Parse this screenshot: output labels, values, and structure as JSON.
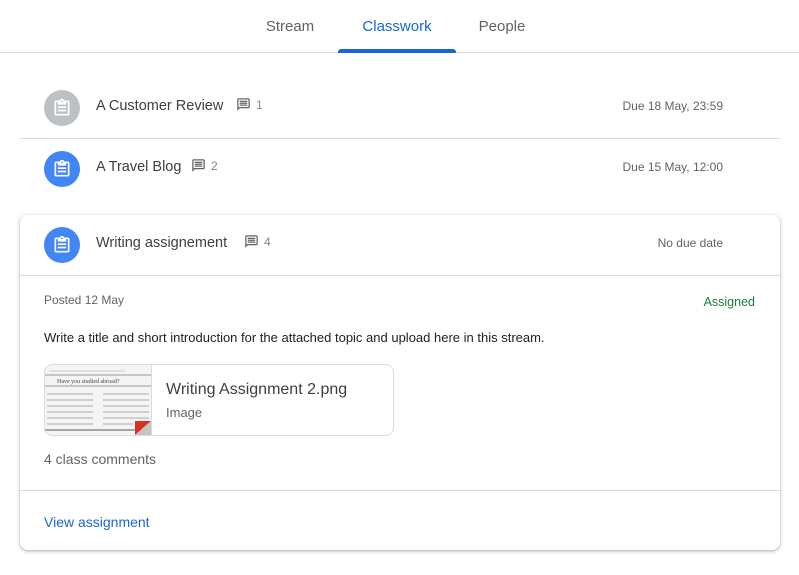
{
  "tabs": [
    {
      "label": "Stream",
      "active": false
    },
    {
      "label": "Classwork",
      "active": true
    },
    {
      "label": "People",
      "active": false
    }
  ],
  "assignments": [
    {
      "title": "A Customer Review",
      "comments": "1",
      "due": "Due 18 May, 23:59",
      "icon": "assignment-icon",
      "color": "#bdc1c6"
    },
    {
      "title": "A Travel Blog",
      "comments": "2",
      "due": "Due 15 May, 12:00",
      "icon": "assignment-icon",
      "color": "#4285f4"
    }
  ],
  "expanded": {
    "title": "Writing assignement",
    "comments": "4",
    "due": "No due date",
    "posted": "Posted 12 May",
    "status": "Assigned",
    "description": "Write a title and short introduction for the attached topic and upload here in this stream.",
    "attachment": {
      "name": "Writing Assignment 2.png",
      "type": "Image",
      "thumb_heading": "Have you studied abroad?"
    },
    "class_comments": "4 class comments",
    "view_link": "View assignment"
  },
  "colors": {
    "accent": "#1967d2",
    "assigned": "#188038",
    "divider": "#dadce0"
  }
}
